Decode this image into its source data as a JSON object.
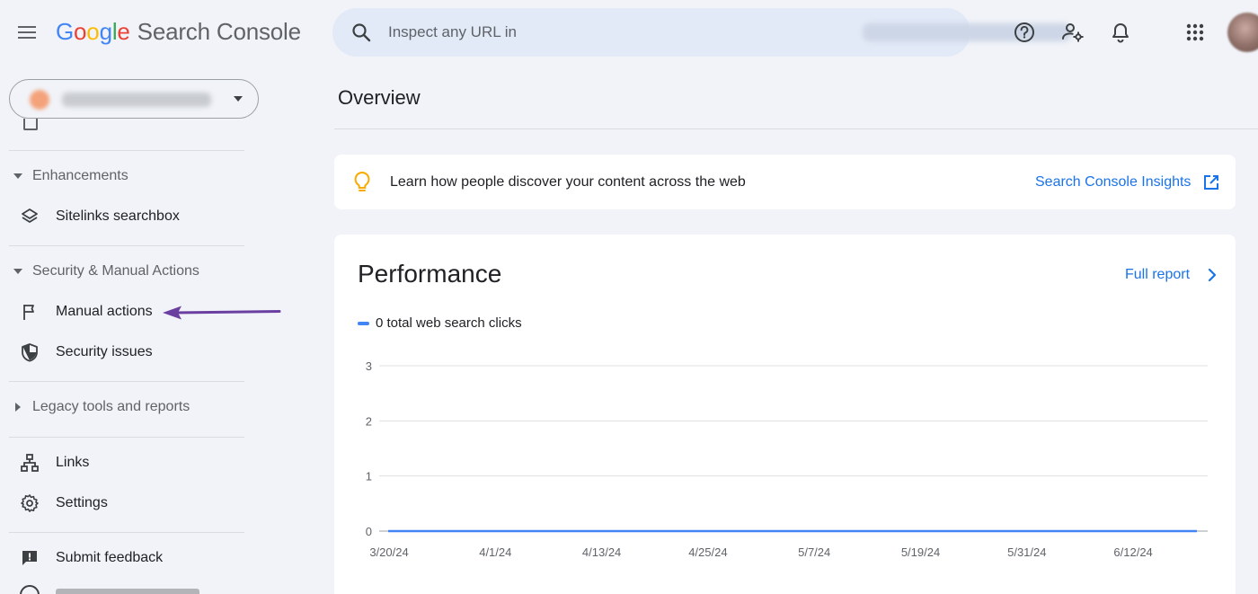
{
  "header": {
    "logo_letters": [
      {
        "ch": "G",
        "color": "#4285f4"
      },
      {
        "ch": "o",
        "color": "#ea4335"
      },
      {
        "ch": "o",
        "color": "#fbbc05"
      },
      {
        "ch": "g",
        "color": "#4285f4"
      },
      {
        "ch": "l",
        "color": "#34a853"
      },
      {
        "ch": "e",
        "color": "#ea4335"
      }
    ],
    "product_name": "Search Console",
    "search_placeholder": "Inspect any URL in",
    "icons": [
      "help-icon",
      "manage-users-icon",
      "notifications-icon",
      "apps-icon"
    ]
  },
  "sidebar": {
    "sections": [
      {
        "title": "Enhancements",
        "expanded": true,
        "items": [
          {
            "label": "Sitelinks searchbox",
            "icon": "layers-icon"
          }
        ]
      },
      {
        "title": "Security & Manual Actions",
        "expanded": true,
        "items": [
          {
            "label": "Manual actions",
            "icon": "flag-icon"
          },
          {
            "label": "Security issues",
            "icon": "shield-icon"
          }
        ]
      },
      {
        "title": "Legacy tools and reports",
        "expanded": false,
        "items": []
      }
    ],
    "bottom_items": [
      {
        "label": "Links",
        "icon": "sitemap-icon"
      },
      {
        "label": "Settings",
        "icon": "gear-icon"
      }
    ],
    "footer_items": [
      {
        "label": "Submit feedback",
        "icon": "feedback-icon"
      }
    ],
    "annotation_color": "#6b3fa0"
  },
  "main": {
    "page_title": "Overview",
    "insight": {
      "message": "Learn how people discover your content across the web",
      "link_label": "Search Console Insights",
      "bulb_color": "#f9ab00"
    },
    "performance": {
      "title": "Performance",
      "full_report_label": "Full report",
      "legend_label": "0 total web search clicks"
    }
  },
  "chart_data": {
    "type": "line",
    "title": "",
    "series": [
      {
        "name": "0 total web search clicks",
        "color": "#4285f4",
        "values": [
          0,
          0,
          0,
          0,
          0,
          0,
          0,
          0
        ]
      }
    ],
    "x_ticks": [
      "3/20/24",
      "4/1/24",
      "4/13/24",
      "4/25/24",
      "5/7/24",
      "5/19/24",
      "5/31/24",
      "6/12/24"
    ],
    "y_ticks": [
      0,
      1,
      2,
      3
    ],
    "ylim": [
      0,
      3
    ],
    "grid": true
  },
  "colors": {
    "accent": "#1a73e8",
    "page_bg": "#f1f3f8",
    "card_bg": "#ffffff"
  }
}
